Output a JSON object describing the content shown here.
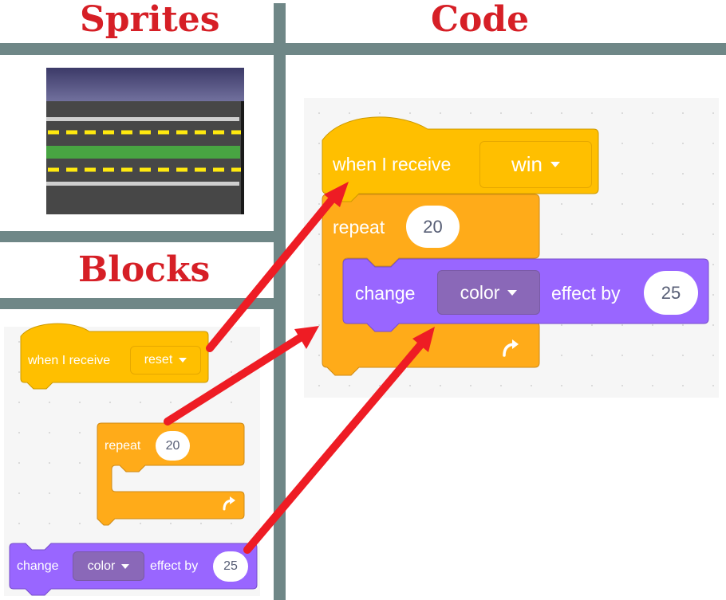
{
  "titles": {
    "sprites": "Sprites",
    "code": "Code",
    "blocks": "Blocks"
  },
  "code": {
    "event_block": {
      "label": "when I receive",
      "message": "win"
    },
    "repeat_block": {
      "label": "repeat",
      "count": "20"
    },
    "effect_block": {
      "label": "change",
      "effect": "color",
      "by_label": "effect by",
      "amount": "25"
    }
  },
  "palette": {
    "event_block": {
      "label": "when I receive",
      "message": "reset"
    },
    "repeat_block": {
      "label": "repeat",
      "count": "20"
    },
    "effect_block": {
      "label": "change",
      "effect": "color",
      "by_label": "effect by",
      "amount": "25"
    }
  },
  "colors": {
    "title": "#d61f26",
    "divider": "#6f8787",
    "events": "#ffbf00",
    "control": "#ffab19",
    "looks": "#9966ff",
    "arrow": "#ee1c24"
  },
  "icons": {
    "sprite": "road-sprite-thumbnail",
    "loop": "loop-arrow-icon",
    "dropdown": "caret-down-icon"
  }
}
